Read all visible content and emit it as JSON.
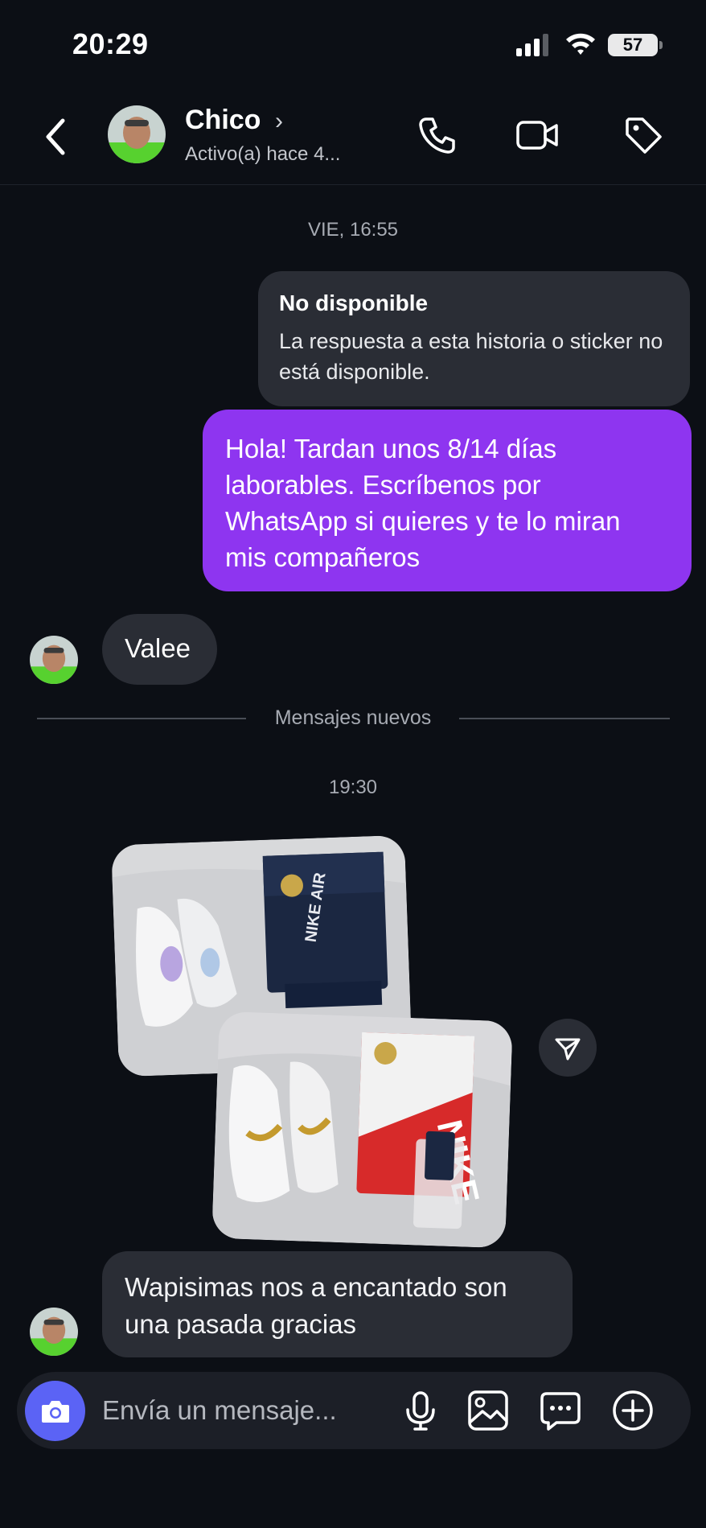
{
  "status_bar": {
    "time": "20:29",
    "battery": "57"
  },
  "header": {
    "name": "Chico",
    "status": "Activo(a) hace 4..."
  },
  "messages": {
    "timestamp_1": "VIE, 16:55",
    "unavailable_title": "No disponible",
    "unavailable_body": "La respuesta a esta historia o sticker no está disponible.",
    "sent_text": "Hola! Tardan unos 8/14 días laborables. Escríbenos por WhatsApp si quieres y te lo miran mis compañeros",
    "reply_short": "Valee",
    "new_messages_label": "Mensajes nuevos",
    "timestamp_2": "19:30",
    "reply_long": "Wapisimas nos a encantado son una pasada gracias"
  },
  "composer": {
    "placeholder": "Envía un mensaje..."
  },
  "colors": {
    "background": "#0c0f15",
    "sent_bubble": "#8e35f0",
    "received_bubble": "#2a2d35",
    "camera_button": "#5b63f5"
  }
}
